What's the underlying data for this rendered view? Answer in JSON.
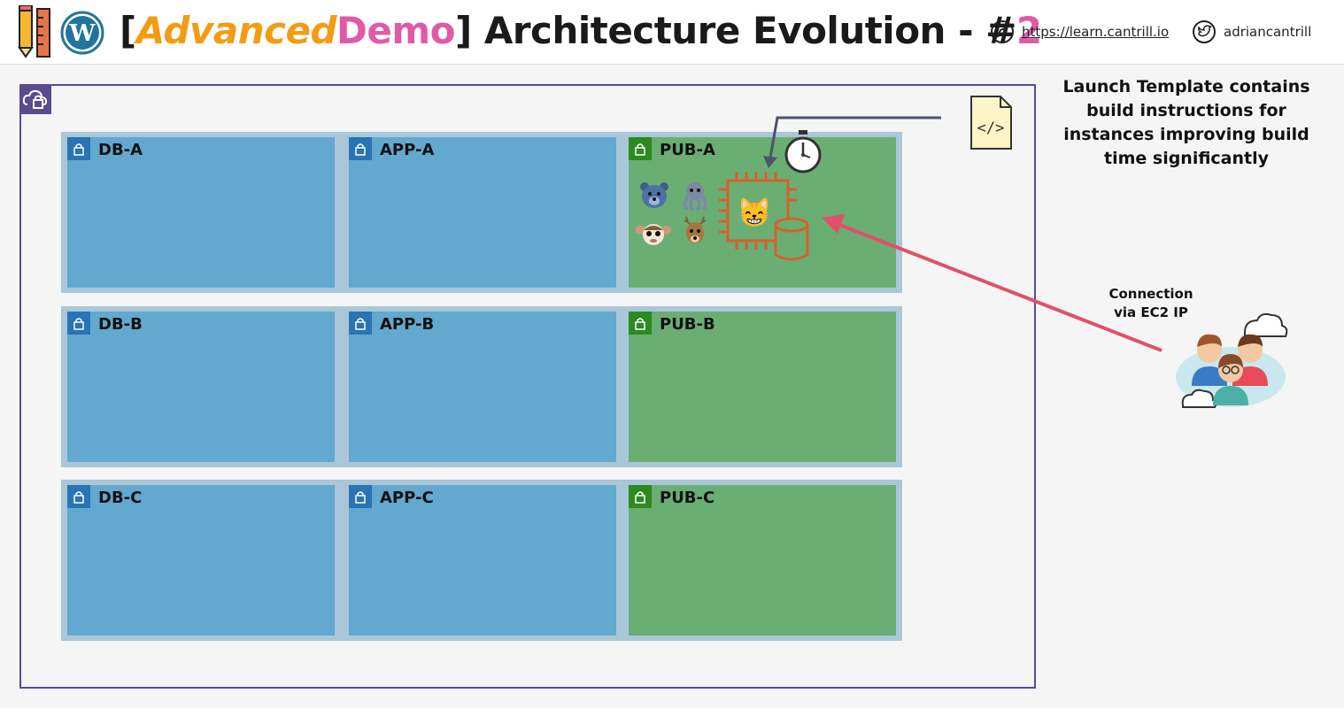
{
  "header": {
    "title_open": "[",
    "title_advanced": "Advanced",
    "title_demo": "Demo",
    "title_close": "] Architecture Evolution - #",
    "title_number": "2",
    "site_link": "https://learn.cantrill.io",
    "twitter_handle": "adriancantrill",
    "icons": [
      "pencil-ruler-icon",
      "wordpress-logo",
      "safari-compass-icon",
      "twitter-bird-icon"
    ]
  },
  "diagram": {
    "vpc_icon": "cloud-lock-icon",
    "subnets": [
      {
        "label": "DB-A",
        "type": "private"
      },
      {
        "label": "APP-A",
        "type": "private"
      },
      {
        "label": "PUB-A",
        "type": "public"
      },
      {
        "label": "DB-B",
        "type": "private"
      },
      {
        "label": "APP-B",
        "type": "private"
      },
      {
        "label": "PUB-B",
        "type": "public"
      },
      {
        "label": "DB-C",
        "type": "private"
      },
      {
        "label": "APP-C",
        "type": "private"
      },
      {
        "label": "PUB-C",
        "type": "public"
      }
    ],
    "launch_template_note": "Launch Template contains build instructions for instances improving build time significantly",
    "connection_note_line1": "Connection",
    "connection_note_line2": "via EC2 IP",
    "ec2_emoji": "😸",
    "pet_icons": [
      "bear-icon",
      "octopus-icon",
      "gremlin-icon",
      "deer-icon"
    ],
    "colors": {
      "private_subnet": "#62a8cf",
      "public_subnet": "#6aae74",
      "private_lock": "#2874b4",
      "public_lock": "#2c8a1f",
      "vpc_border": "#5a4a8f",
      "ec2_orange": "#d4622a",
      "arrow_red": "#e0506a",
      "accent_orange": "#f39c12",
      "accent_pink": "#e05aa6"
    }
  }
}
